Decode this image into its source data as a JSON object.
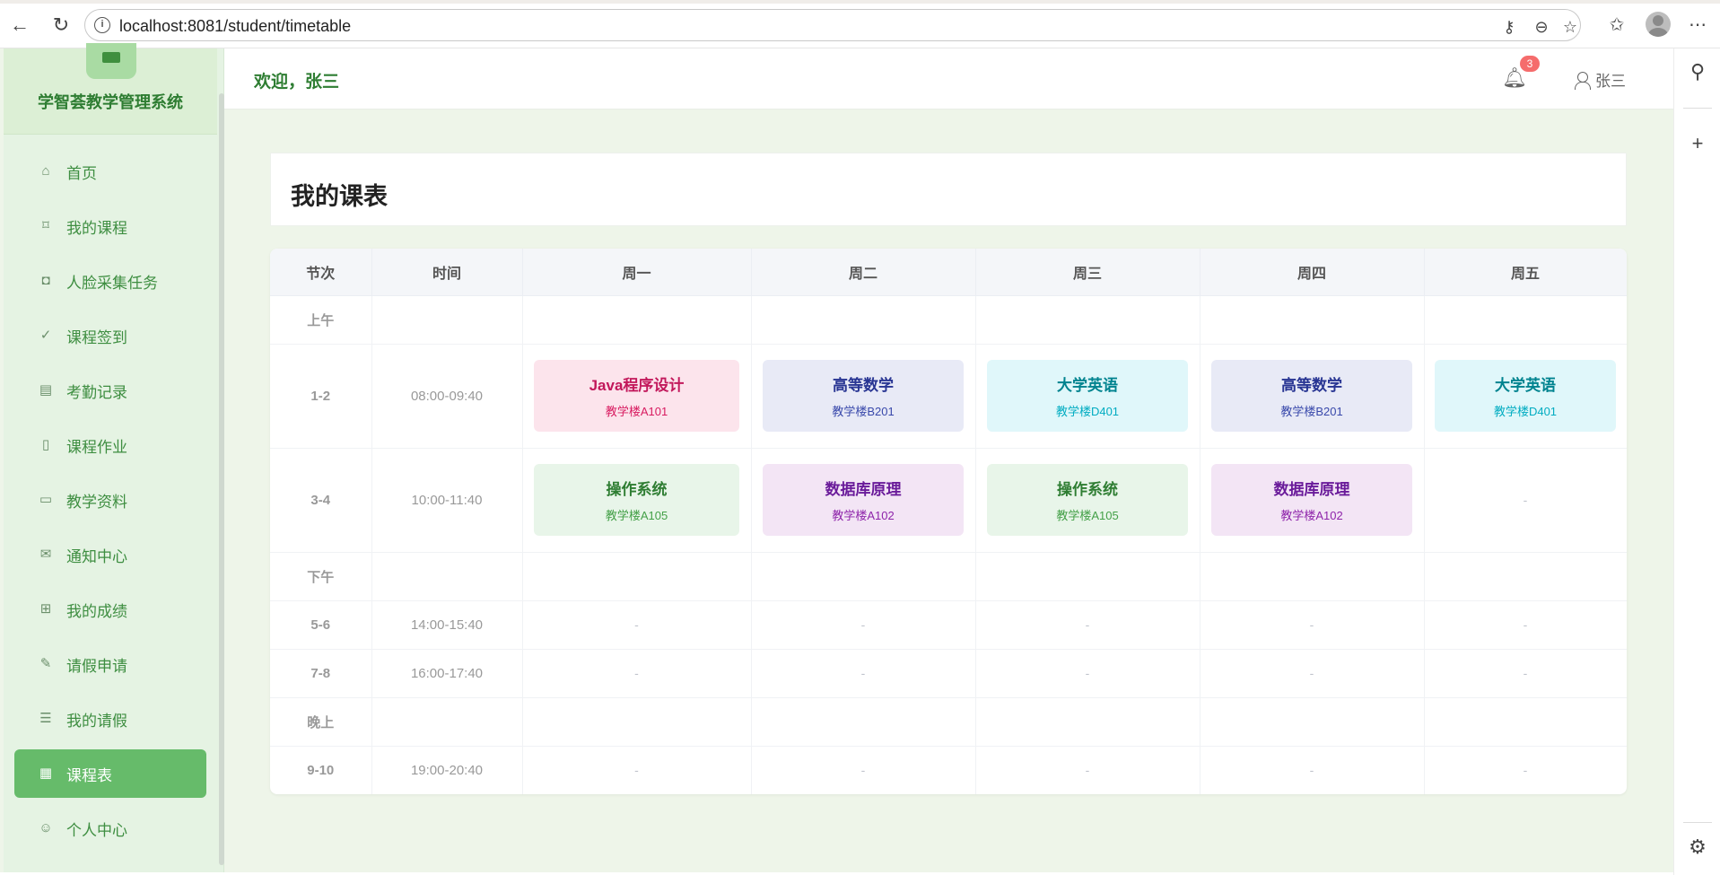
{
  "browser": {
    "url": "localhost:8081/student/timetable"
  },
  "app": {
    "brand_title": "学智荟教学管理系统",
    "welcome": "欢迎，张三",
    "notification_count": "3",
    "user_name": "张三",
    "page_title": "我的课表"
  },
  "sidebar": {
    "items": [
      {
        "label": "首页",
        "icon": "home-icon"
      },
      {
        "label": "我的课程",
        "icon": "bookmark-icon"
      },
      {
        "label": "人脸采集任务",
        "icon": "camera-icon"
      },
      {
        "label": "课程签到",
        "icon": "check-icon"
      },
      {
        "label": "考勤记录",
        "icon": "notebook-icon"
      },
      {
        "label": "课程作业",
        "icon": "document-icon"
      },
      {
        "label": "教学资料",
        "icon": "folder-icon"
      },
      {
        "label": "通知中心",
        "icon": "mail-icon"
      },
      {
        "label": "我的成绩",
        "icon": "chart-board-icon"
      },
      {
        "label": "请假申请",
        "icon": "pen-icon"
      },
      {
        "label": "我的请假",
        "icon": "list-doc-icon"
      },
      {
        "label": "课程表",
        "icon": "calendar-icon",
        "active": true
      },
      {
        "label": "个人中心",
        "icon": "user-icon"
      }
    ]
  },
  "timetable": {
    "headers": [
      "节次",
      "时间",
      "周一",
      "周二",
      "周三",
      "周四",
      "周五"
    ],
    "segments": {
      "morning": "上午",
      "afternoon": "下午",
      "evening": "晚上"
    },
    "empty": "-",
    "rows": {
      "p12": {
        "slot": "1-2",
        "time": "08:00-09:40",
        "cells": [
          {
            "name": "Java程序设计",
            "room": "教学楼A101",
            "color": "pink"
          },
          {
            "name": "高等数学",
            "room": "教学楼B201",
            "color": "indigo"
          },
          {
            "name": "大学英语",
            "room": "教学楼D401",
            "color": "cyan"
          },
          {
            "name": "高等数学",
            "room": "教学楼B201",
            "color": "indigo"
          },
          {
            "name": "大学英语",
            "room": "教学楼D401",
            "color": "cyan"
          }
        ]
      },
      "p34": {
        "slot": "3-4",
        "time": "10:00-11:40",
        "cells": [
          {
            "name": "操作系统",
            "room": "教学楼A105",
            "color": "green"
          },
          {
            "name": "数据库原理",
            "room": "教学楼A102",
            "color": "purple"
          },
          {
            "name": "操作系统",
            "room": "教学楼A105",
            "color": "green"
          },
          {
            "name": "数据库原理",
            "room": "教学楼A102",
            "color": "purple"
          }
        ]
      },
      "p56": {
        "slot": "5-6",
        "time": "14:00-15:40"
      },
      "p78": {
        "slot": "7-8",
        "time": "16:00-17:40"
      },
      "p910": {
        "slot": "9-10",
        "time": "19:00-20:40"
      }
    }
  },
  "colors": {
    "brand_green": "#2e7d32",
    "active_menu": "#66bb6a",
    "badge_red": "#f56c6c"
  }
}
